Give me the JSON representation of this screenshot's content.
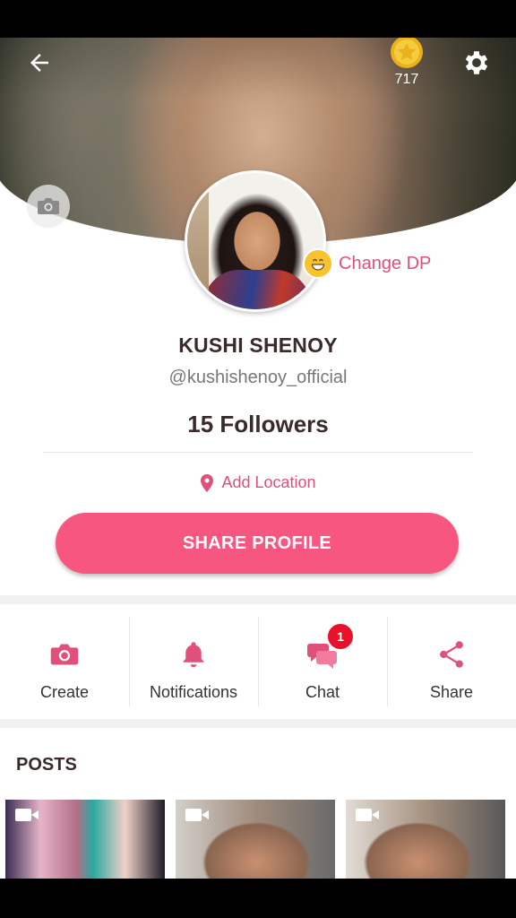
{
  "header": {
    "coin_count": "717"
  },
  "cover": {
    "change_dp_label": "Change DP"
  },
  "profile": {
    "name": "KUSHI SHENOY",
    "handle": "@kushishenoy_official",
    "followers": "15 Followers",
    "location_label": "Add Location",
    "share_label": "SHARE PROFILE"
  },
  "actions": [
    {
      "label": "Create",
      "icon": "camera-icon"
    },
    {
      "label": "Notifications",
      "icon": "bell-icon"
    },
    {
      "label": "Chat",
      "icon": "chat-bubbles-icon",
      "badge": "1"
    },
    {
      "label": "Share",
      "icon": "share-icon"
    }
  ],
  "posts": {
    "title": "POSTS",
    "items": [
      {
        "type": "video"
      },
      {
        "type": "video"
      },
      {
        "type": "video"
      }
    ]
  },
  "colors": {
    "accent": "#e0507a",
    "button": "#f6567f",
    "badge": "#e8132b"
  }
}
